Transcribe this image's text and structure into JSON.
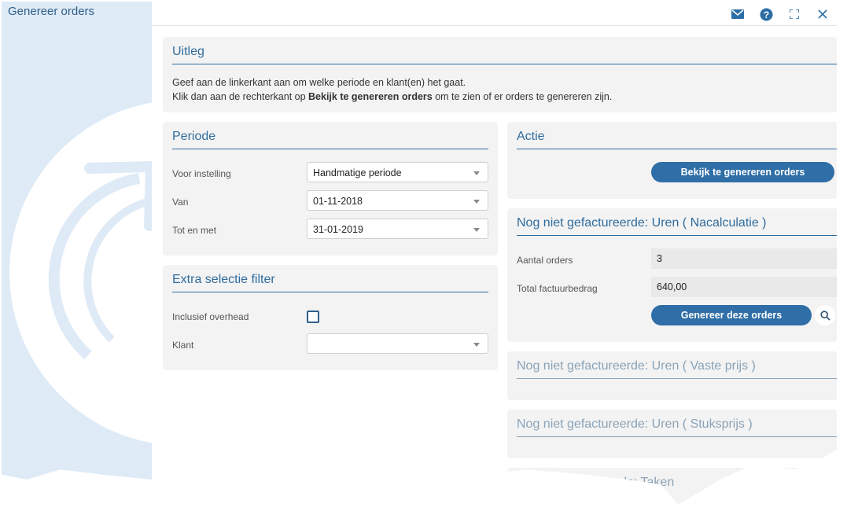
{
  "window": {
    "title": "Genereer orders",
    "icons": [
      "mail-icon",
      "help-icon",
      "fullscreen-icon",
      "close-icon"
    ]
  },
  "uitleg": {
    "heading": "Uitleg",
    "line1": "Geef aan de linkerkant aan om welke periode en klant(en) het gaat.",
    "line2_prefix": "Klik dan aan de rechterkant op ",
    "line2_bold": "Bekijk te genereren orders",
    "line2_suffix": " om te zien of er orders te genereren zijn."
  },
  "periode": {
    "heading": "Periode",
    "voor_instelling_label": "Voor instelling",
    "voor_instelling_value": "Handmatige periode",
    "van_label": "Van",
    "van_value": "01-11-2018",
    "tot_label": "Tot en met",
    "tot_value": "31-01-2019"
  },
  "filter": {
    "heading": "Extra selectie filter",
    "overhead_label": "Inclusief overhead",
    "overhead_checked": false,
    "klant_label": "Klant",
    "klant_value": ""
  },
  "actie": {
    "heading": "Actie",
    "button": "Bekijk te genereren orders"
  },
  "nacalculatie": {
    "heading": "Nog niet gefactureerde: Uren ( Nacalculatie )",
    "aantal_label": "Aantal orders",
    "aantal_value": "3",
    "totaal_label": "Total factuurbedrag",
    "totaal_value": "640,00",
    "button": "Genereer deze orders"
  },
  "vaste_prijs": {
    "heading": "Nog niet gefactureerde: Uren ( Vaste prijs )"
  },
  "stuksprijs": {
    "heading": "Nog niet gefactureerde: Uren ( Stuksprijs )"
  },
  "taken": {
    "heading_fragment": "eerde: Taken"
  },
  "colors": {
    "accent": "#2f6ea6",
    "heading": "#2f6c9e",
    "sidebar": "#deeaf6",
    "panel": "#f3f3f3"
  }
}
